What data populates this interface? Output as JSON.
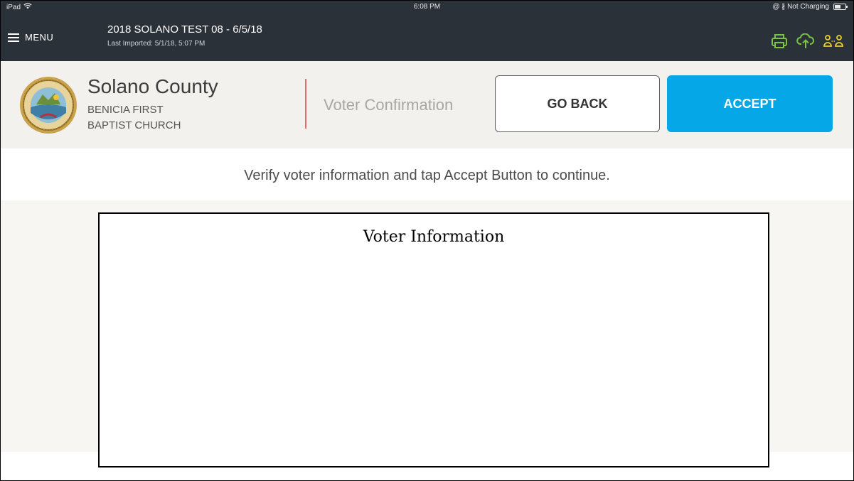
{
  "status_bar": {
    "device": "iPad",
    "wifi_icon": "wifi-icon",
    "time": "6:08 PM",
    "indicators": "@ ∦ Not Charging"
  },
  "app_bar": {
    "menu_label": "MENU",
    "election_title": "2018 SOLANO TEST 08 - 6/5/18",
    "last_imported": "Last Imported: 5/1/18, 5:07 PM",
    "icons": [
      "printer-icon",
      "cloud-upload-icon",
      "users-sync-icon"
    ],
    "icon_colors": {
      "printer": "#7cc243",
      "cloud": "#7cc243",
      "users": "#e8d02a"
    }
  },
  "header": {
    "county": "Solano County",
    "location_line1": "BENICIA FIRST",
    "location_line2": "BAPTIST CHURCH",
    "screen_title": "Voter Confirmation",
    "go_back_label": "GO BACK",
    "accept_label": "ACCEPT"
  },
  "instruction": "Verify voter information and tap Accept Button to continue.",
  "voter_info": {
    "title": "Voter Information"
  },
  "colors": {
    "top_bar": "#2b3138",
    "accept": "#06a7e6",
    "divider": "#e36a73"
  }
}
